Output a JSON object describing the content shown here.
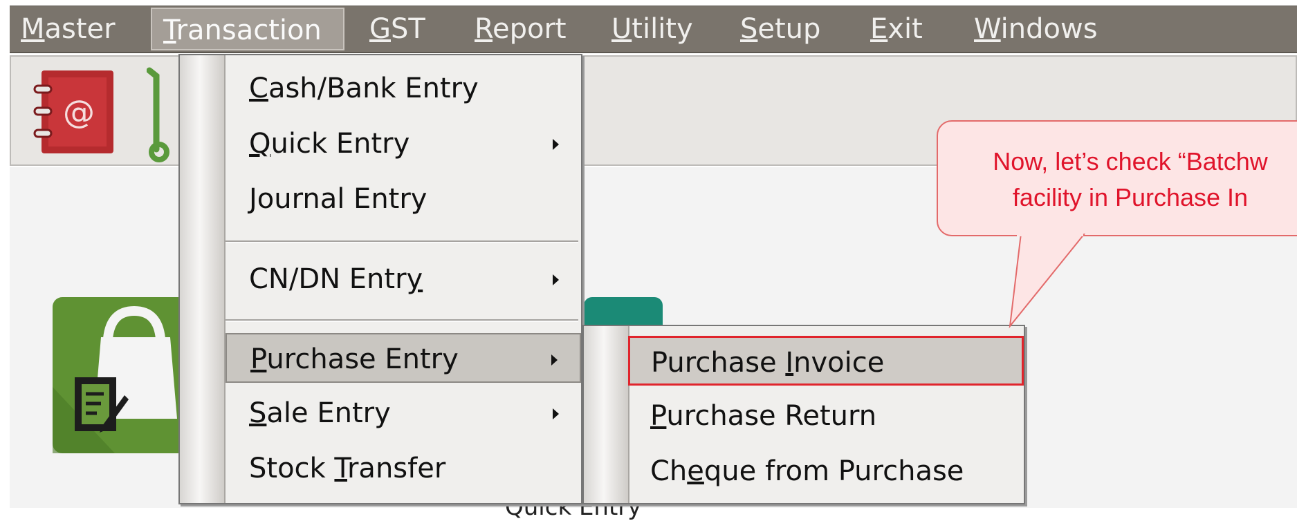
{
  "menubar": {
    "items": [
      {
        "pre": "",
        "key": "M",
        "post": "aster"
      },
      {
        "pre": "",
        "key": "T",
        "post": "ransaction"
      },
      {
        "pre": "",
        "key": "G",
        "post": "ST"
      },
      {
        "pre": "",
        "key": "R",
        "post": "eport"
      },
      {
        "pre": "",
        "key": "U",
        "post": "tility"
      },
      {
        "pre": "",
        "key": "S",
        "post": "etup"
      },
      {
        "pre": "",
        "key": "E",
        "post": "xit"
      },
      {
        "pre": "",
        "key": "W",
        "post": "indows"
      }
    ]
  },
  "transaction_menu": {
    "items": [
      {
        "pre": "",
        "key": "C",
        "post": "ash/Bank Entry"
      },
      {
        "pre": "",
        "key": "Q",
        "post": "uick Entry"
      },
      {
        "pre": "",
        "key": "J",
        "post": "ournal Entry"
      },
      {
        "pre": "CN/DN Entr",
        "key": "y",
        "post": ""
      },
      {
        "pre": "",
        "key": "P",
        "post": "urchase Entry"
      },
      {
        "pre": "",
        "key": "S",
        "post": "ale Entry"
      },
      {
        "pre": "Stock ",
        "key": "T",
        "post": "ransfer"
      }
    ]
  },
  "purchase_submenu": {
    "items": [
      {
        "pre": "Purchase ",
        "key": "I",
        "post": "nvoice"
      },
      {
        "pre": "",
        "key": "P",
        "post": "urchase Return"
      },
      {
        "pre": "Ch",
        "key": "e",
        "post": "que from Purchase"
      }
    ]
  },
  "callout": {
    "line1": "Now, let’s check “Batchw",
    "line2": "facility in Purchase In"
  },
  "background": {
    "quick_entry_partial": "Quick Entry"
  },
  "colors": {
    "menubar_bg": "#7a746c",
    "highlight_box": "#e0242c",
    "callout_text": "#e0142b",
    "callout_bg": "#fde5e5"
  },
  "icons": [
    "address-book-icon",
    "trolley-icon",
    "purchase-bag-icon",
    "edit-document-icon",
    "submenu-arrow-icon"
  ]
}
